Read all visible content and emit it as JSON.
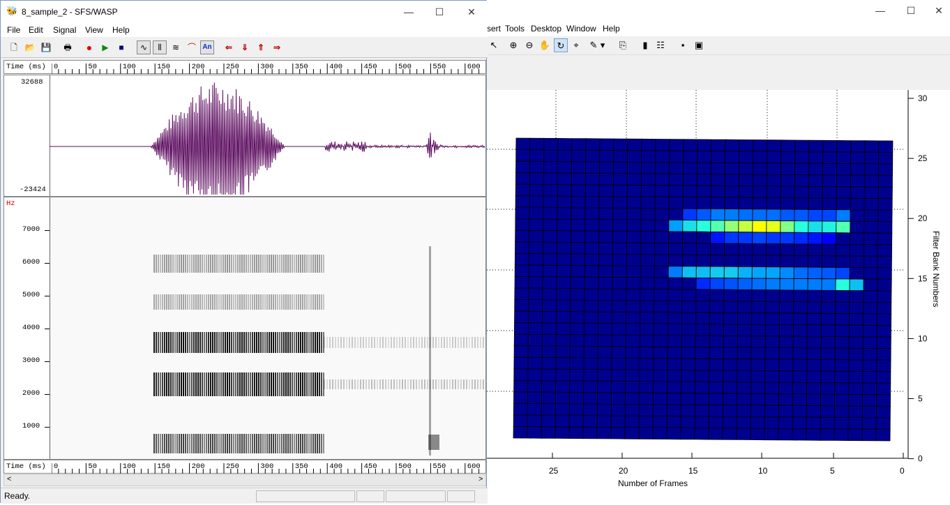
{
  "matlab": {
    "menu": [
      "sert",
      "Tools",
      "Desktop",
      "Window",
      "Help"
    ],
    "window_controls": {
      "minimize": "—",
      "maximize": "☐",
      "close": "✕"
    },
    "plot": {
      "xlabel": "Number of Frames",
      "ylabel": "Filter Bank Numbers",
      "xticks": [
        "25",
        "20",
        "15",
        "10",
        "5",
        "0"
      ],
      "yticks": [
        "30",
        "25",
        "20",
        "15",
        "10",
        "5",
        "0"
      ]
    }
  },
  "chart_data": {
    "type": "heatmap",
    "xlabel": "Number of Frames",
    "ylabel": "Filter Bank Numbers",
    "xlim": [
      0,
      28
    ],
    "ylim": [
      0,
      30
    ],
    "cols": 27,
    "rows": 26,
    "hot_cells": [
      {
        "row": 19,
        "cols_from": 16,
        "cols_to": 4,
        "values": [
          0.35,
          0.45,
          0.5,
          0.55,
          0.62,
          0.68,
          0.75,
          0.72,
          0.6,
          0.5,
          0.45,
          0.48,
          0.55,
          0.85,
          1.0
        ]
      },
      {
        "row": 20,
        "cols_from": 15,
        "cols_to": 4,
        "values": [
          0.2,
          0.25,
          0.3,
          0.3,
          0.28,
          0.28,
          0.28,
          0.25,
          0.25,
          0.22,
          0.22,
          0.3
        ]
      },
      {
        "row": 18,
        "cols_from": 13,
        "cols_to": 5,
        "values": [
          0.15,
          0.2,
          0.2,
          0.22,
          0.2,
          0.2,
          0.18,
          0.15,
          0.12
        ]
      },
      {
        "row": 15,
        "cols_from": 16,
        "cols_to": 4,
        "values": [
          0.3,
          0.4,
          0.4,
          0.42,
          0.42,
          0.38,
          0.36,
          0.36,
          0.32,
          0.28,
          0.26,
          0.25,
          0.22
        ]
      },
      {
        "row": 14,
        "cols_from": 14,
        "cols_to": 3,
        "values": [
          0.18,
          0.22,
          0.24,
          0.26,
          0.28,
          0.3,
          0.3,
          0.3,
          0.3,
          0.3,
          0.5,
          0.4
        ]
      }
    ]
  },
  "sfs": {
    "title": "8_sample_2 - SFS/WASP",
    "window_controls": {
      "minimize": "—",
      "maximize": "☐",
      "close": "✕"
    },
    "menu": [
      "File",
      "Edit",
      "Signal",
      "View",
      "Help"
    ],
    "toolbar": {
      "new": "🗋",
      "open": "📂",
      "save": "💾",
      "print": "🖶",
      "record": "●",
      "play": "▶",
      "stop": "■",
      "wave": "∿",
      "spect": "⦀",
      "lpc": "≋",
      "pitch": "⌒",
      "annot": "An",
      "left": "⇐",
      "down": "⇓",
      "up": "⇑",
      "right": "⇒"
    },
    "time_axis": {
      "label": "Time (ms)",
      "ticks": [
        "0",
        "50",
        "100",
        "150",
        "200",
        "250",
        "300",
        "350",
        "400",
        "450",
        "500",
        "550",
        "600"
      ]
    },
    "waveform": {
      "ymax": "32688",
      "ymin": "-23424"
    },
    "spectrogram": {
      "unit": "Hz",
      "yticks": [
        "7000",
        "6000",
        "5000",
        "4000",
        "3000",
        "2000",
        "1000"
      ]
    },
    "status": "Ready."
  },
  "colors": {
    "wave": "#5b0a5e",
    "heat_low": "#00008f",
    "accent_red": "#cc0000",
    "hz_label": "#cc0000"
  }
}
